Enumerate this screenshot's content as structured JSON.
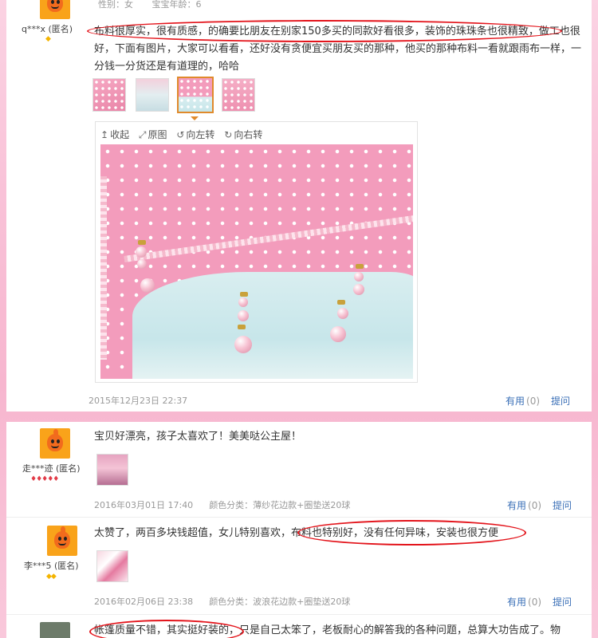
{
  "review1": {
    "user": "q***x (匿名)",
    "meta_gender": "性别：女",
    "meta_age": "宝宝年龄：6",
    "text": "布料很厚实，很有质感，的确要比朋友在别家150多买的同款好看很多，装饰的珠珠条也很精致，做工也很好，下面有图片，大家可以看看，还好没有贪便宜买朋友买的那种，他买的那种布料一看就跟雨布一样，一分钱一分货还是有道理的，哈哈",
    "toolbar": {
      "collapse": "收起",
      "fullsize": "原图",
      "rotate_left": "向左转",
      "rotate_right": "向右转"
    },
    "date": "2015年12月23日 22:37",
    "useful_label": "有用",
    "useful_count": "(0)",
    "ask_label": "提问"
  },
  "review2": {
    "user": "走***迹 (匿名)",
    "text": "宝贝好漂亮，孩子太喜欢了！美美哒公主屋！",
    "date": "2016年03月01日 17:40",
    "category": "颜色分类：薄纱花边款+圈垫送20球",
    "useful_label": "有用",
    "useful_count": "(0)",
    "ask_label": "提问"
  },
  "review3": {
    "user": "李***5 (匿名)",
    "text": "太赞了，两百多块钱超值，女儿特别喜欢，布料也特别好，没有任何异味，安装也很方便",
    "date": "2016年02月06日 23:38",
    "category": "颜色分类：波浪花边款+圈垫送20球",
    "useful_label": "有用",
    "useful_count": "(0)",
    "ask_label": "提问"
  },
  "review4": {
    "text": "帐篷质量不错，其实挺好装的，只是自己太笨了，老板耐心的解答我的各种问题，总算大功告成了。物"
  },
  "colors": {
    "link": "#3a6fb7",
    "annotation_red": "#e3141b",
    "selected_thumb": "#e08a2b"
  }
}
